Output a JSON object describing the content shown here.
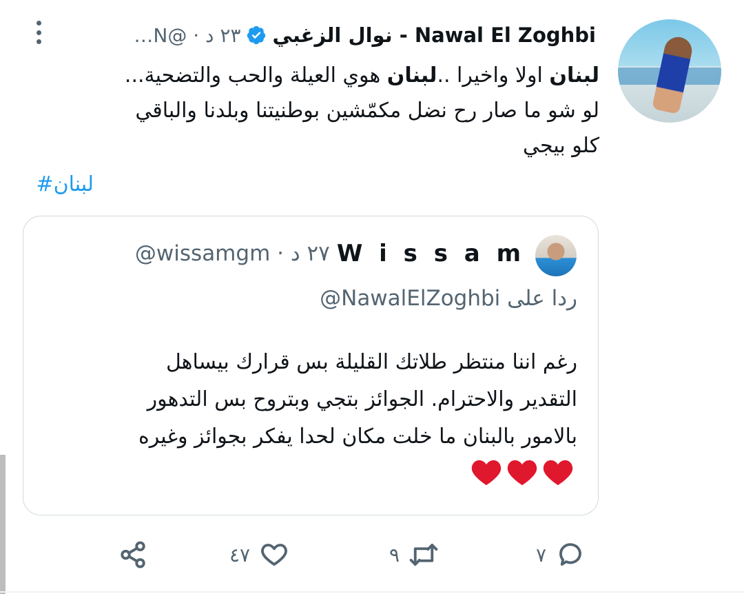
{
  "tweet": {
    "author_name": "نوال الزغبي - Nawal El Zoghbi",
    "meta": "…N@ · ٢٣ د",
    "line1_bold_a": "لبنان",
    "line1_a": " اولا واخيرا ..",
    "line1_bold_b": "لبنان",
    "line1_b": " هوي العيلة والحب والتضحية...",
    "line2": "لو شو ما صار رح نضل مكمّشين بوطنيتنا وبلدنا والباقي",
    "line3": "كلو بيجي",
    "hashtag": "لبنان#"
  },
  "quote": {
    "author_name": "W i s s a m",
    "meta": "@wissamgm · ٢٧ د",
    "reply_prefix": "ردا على",
    "reply_handle": "@NawalElZoghbi",
    "line1": "رغم اننا منتظر طلاتك القليلة بس قرارك بيساهل",
    "line2": "التقدير والاحترام. الجوائز بتجي وبتروح بس التدهور",
    "line3": "بالامور بالبنان ما خلت مكان لحدا يفكر بجوائز وغيره"
  },
  "actions": {
    "reply_count": "٧",
    "retweet_count": "٩",
    "like_count": "٤٧"
  },
  "colors": {
    "accent": "#1d9bf0",
    "secondary_text": "#536471",
    "heart": "#e0182d"
  }
}
